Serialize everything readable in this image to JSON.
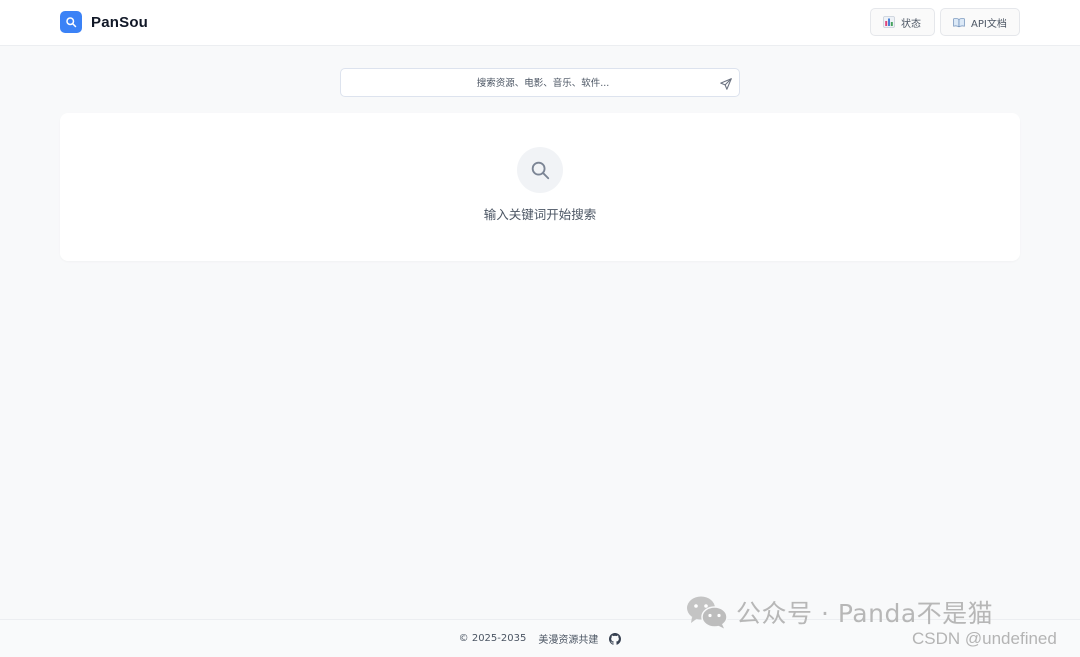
{
  "header": {
    "brand_name": "PanSou",
    "status_label": "状态",
    "api_label": "API文档"
  },
  "search": {
    "placeholder": "搜索资源、电影、音乐、软件..."
  },
  "results": {
    "empty_text": "输入关键词开始搜索"
  },
  "footer": {
    "copyright": "© 2025-2035",
    "link_text": "美漫资源共建"
  },
  "watermark": {
    "line1": "公众号 · Panda不是猫",
    "line2": "CSDN @undefined"
  },
  "icons": {
    "brand": "search-icon",
    "status": "bar-chart-icon",
    "api": "open-book-icon",
    "send": "send-icon",
    "empty": "search-icon",
    "footer": "github-icon"
  },
  "colors": {
    "accent": "#3b82f6",
    "background": "#f8f9fa",
    "card": "#ffffff"
  }
}
